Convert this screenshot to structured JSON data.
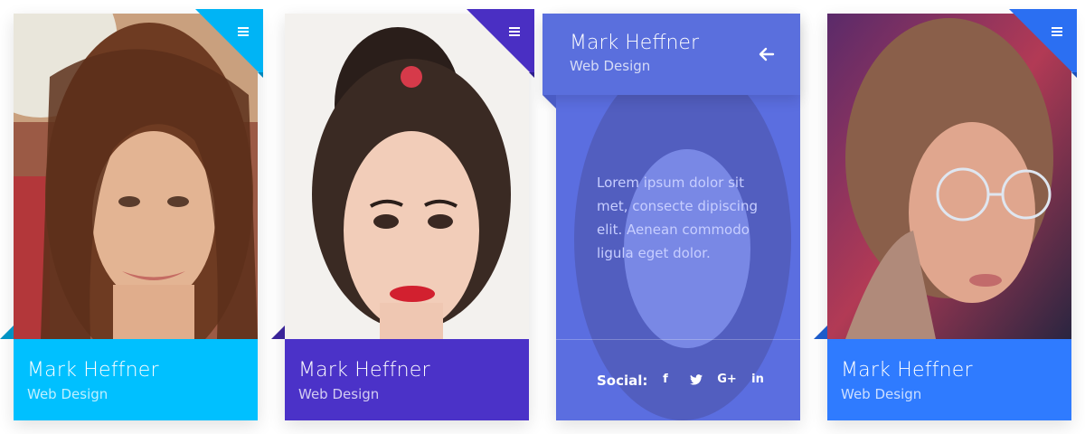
{
  "cards": [
    {
      "name": "Mark Heffner",
      "role": "Web Design",
      "accent": "#00c0ff",
      "corner": "#00b4f5",
      "menu_icon": "hamburger-icon"
    },
    {
      "name": "Mark Heffner",
      "role": "Web Design",
      "accent": "#4b32c8",
      "corner": "#4a2fc3",
      "menu_icon": "hamburger-icon"
    },
    {
      "name": "Mark Heffner",
      "role": "Web Design",
      "accent": "#5a6fdd",
      "description": "Lorem ipsum dolor sit met, consecte dipiscing elit. Aenean commodo ligula eget dolor.",
      "social_label": "Social:",
      "back_icon": "arrow-left-icon",
      "social": [
        {
          "icon": "facebook-icon",
          "glyph": "f"
        },
        {
          "icon": "twitter-icon",
          "glyph": "t"
        },
        {
          "icon": "google-plus-icon",
          "glyph": "G+"
        },
        {
          "icon": "linkedin-icon",
          "glyph": "in"
        }
      ]
    },
    {
      "name": "Mark Heffner",
      "role": "Web Design",
      "accent": "#2f7bff",
      "corner": "#2b6ff2",
      "menu_icon": "hamburger-icon"
    }
  ]
}
